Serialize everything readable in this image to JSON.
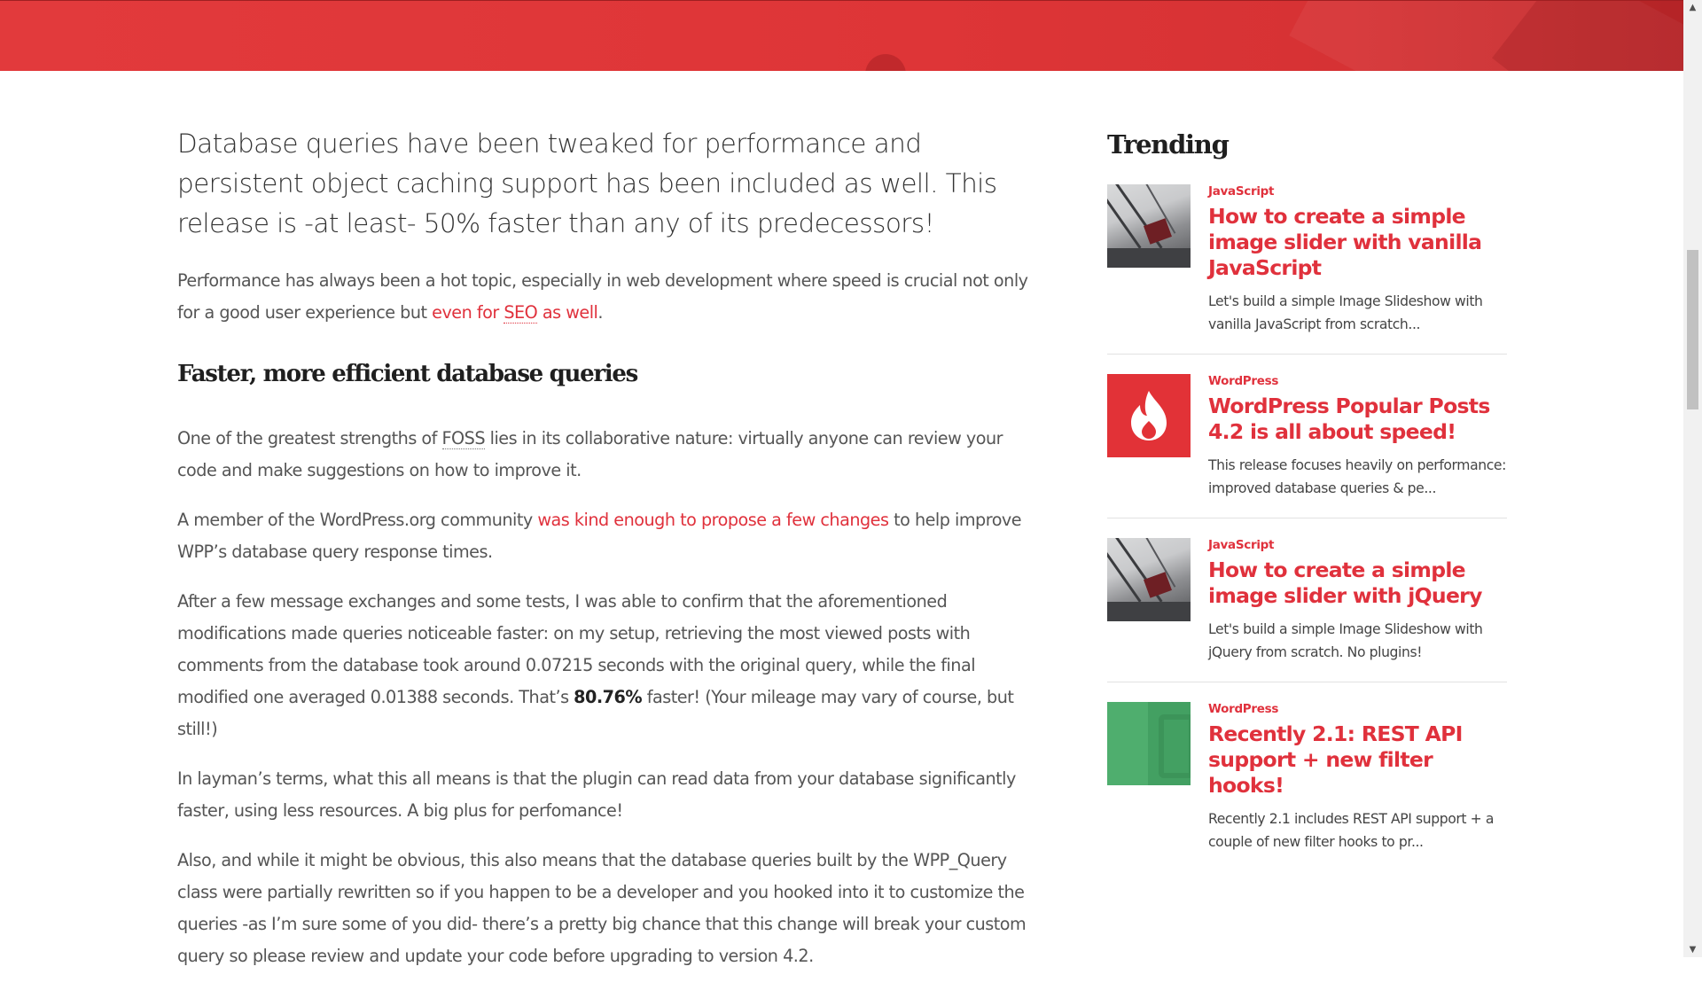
{
  "colors": {
    "accent": "#e0313c",
    "header": "#e23a3c"
  },
  "article": {
    "lead": "Database queries have been tweaked for performance and persistent object caching support has been included as well. This release is -at least- 50% faster than any of its predecessors!",
    "p1_before": "Performance has always been a hot topic, especially in web development where speed is crucial not only for a good user experience but ",
    "p1_link_before": "even for ",
    "p1_link_abbr": "SEO",
    "p1_link_after": " as well",
    "p1_after": ".",
    "heading": "Faster, more efficient database queries",
    "p2_before": "One of the greatest strengths of ",
    "p2_abbr": "FOSS",
    "p2_after": " lies in its collaborative nature: virtually anyone can review your code and make suggestions on how to improve it.",
    "p3_before": "A member of the WordPress.org community ",
    "p3_link": "was kind enough to propose a few changes",
    "p3_after": " to help improve WPP’s database query response times.",
    "p4_before": "After a few message exchanges and some tests, I was able to confirm that the aforementioned modifications made queries noticeable faster: on my setup, retrieving the most viewed posts with comments from the database took around 0.07215 seconds with the original query, while the final modified one averaged 0.01388 seconds. That’s ",
    "p4_strong": "80.76%",
    "p4_after": " faster! (Your mileage may vary of course, but still!)",
    "p5": "In layman’s terms, what this all means is that the plugin can read data from your database significantly faster, using less resources. A big plus for perfomance!",
    "p6": "Also, and while it might be obvious, this also means that the database queries built by the WPP_Query class were partially rewritten so if you happen to be a developer and you hooked into it to customize the queries -as I’m sure some of you did- there’s a pretty big chance that this change will break your custom query so please review and update your code before upgrading to version 4.2."
  },
  "sidebar": {
    "title": "Trending",
    "items": [
      {
        "category": "JavaScript",
        "title": "How to create a simple image slider with vanilla JavaScript",
        "excerpt": "Let's build a simple Image Slideshow with vanilla JavaScript from scratch...",
        "thumb_icon": "swing-ride-photo"
      },
      {
        "category": "WordPress",
        "title": "WordPress Popular Posts 4.2 is all about speed!",
        "excerpt": "This release focuses heavily on performance: improved database queries & pe...",
        "thumb_icon": "flame-icon"
      },
      {
        "category": "JavaScript",
        "title": "How to create a simple image slider with jQuery",
        "excerpt": "Let's build a simple Image Slideshow with jQuery from scratch. No plugins!",
        "thumb_icon": "swing-ride-photo"
      },
      {
        "category": "WordPress",
        "title": "Recently 2.1: REST API support + new filter hooks!",
        "excerpt": "Recently 2.1 includes REST API support + a couple of new filter hooks to pr...",
        "thumb_icon": "recently-plugin-logo"
      }
    ]
  },
  "scrollbar": {
    "position_fraction": 0.26
  }
}
